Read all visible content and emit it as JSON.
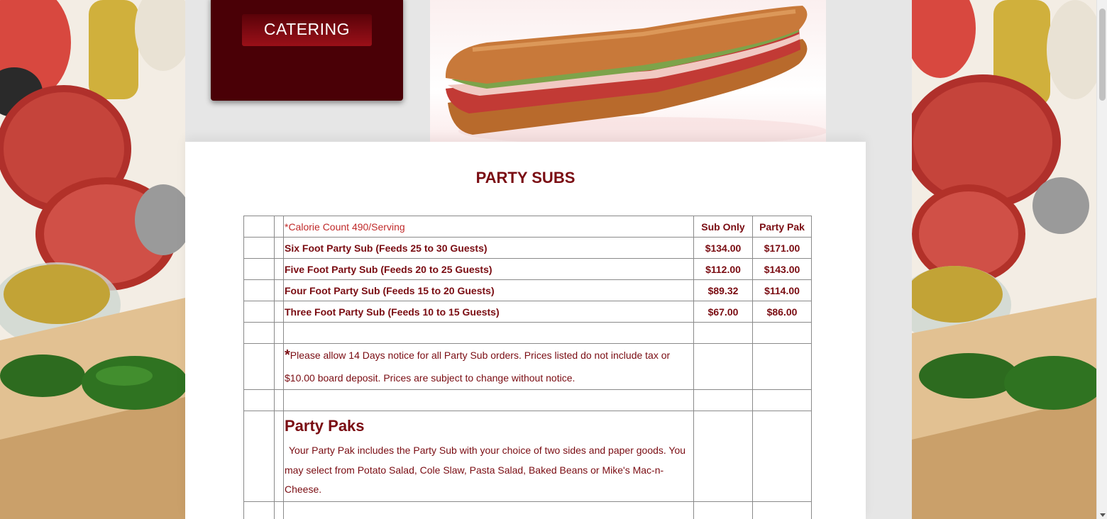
{
  "header": {
    "catering_label": "CATERING"
  },
  "main": {
    "title": "PARTY SUBS",
    "table": {
      "header": {
        "calorie_note": "*Calorie Count 490/Serving",
        "col_sub_only": "Sub Only",
        "col_party_pak": "Party Pak"
      },
      "rows": [
        {
          "item": "Six Foot Party Sub (Feeds 25 to 30 Guests)",
          "sub_only": "$134.00",
          "party_pak": "$171.00"
        },
        {
          "item": "Five Foot Party Sub (Feeds 20 to 25 Guests)",
          "sub_only": "$112.00",
          "party_pak": "$143.00"
        },
        {
          "item": "Four Foot Party Sub (Feeds 15 to 20 Guests)",
          "sub_only": "$89.32",
          "party_pak": "$114.00"
        },
        {
          "item": "Three Foot Party Sub (Feeds 10 to 15 Guests)",
          "sub_only": "$67.00",
          "party_pak": "$86.00"
        }
      ],
      "notice": {
        "star": "*",
        "text": "Please allow 14 Days notice for all Party Sub orders.  Prices listed do not include tax or $10.00 board deposit.  Prices are subject to change without notice."
      },
      "party_paks": {
        "heading": "Party Paks",
        "text": "Your Party Pak includes the Party Sub with your choice of two sides and paper goods. You may select from Potato Salad, Cole Slaw, Pasta Salad, Baked Beans or Mike's Mac-n-Cheese."
      }
    }
  },
  "colors": {
    "brand_dark": "#4a0006",
    "brand_text": "#7a0c12",
    "calorie_text": "#c02a2a"
  },
  "icons": [
    "chevron-down-icon"
  ]
}
